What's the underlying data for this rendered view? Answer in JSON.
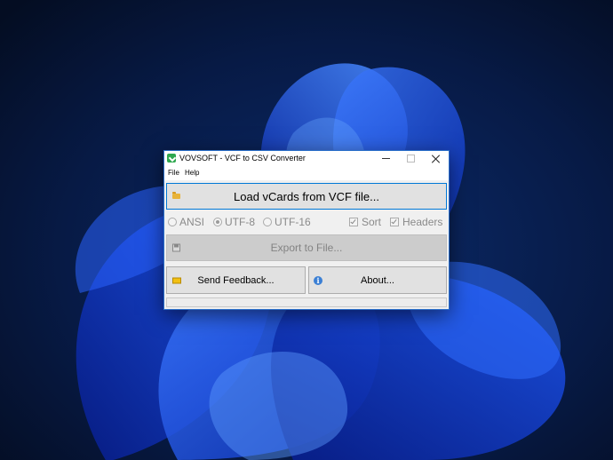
{
  "window": {
    "title": "VOVSOFT - VCF to CSV Converter"
  },
  "menu": {
    "items": [
      "File",
      "Help"
    ]
  },
  "buttons": {
    "load": "Load vCards from VCF file...",
    "export": "Export to File...",
    "feedback": "Send Feedback...",
    "about": "About..."
  },
  "options": {
    "encodings": [
      {
        "label": "ANSI",
        "selected": false
      },
      {
        "label": "UTF-8",
        "selected": true
      },
      {
        "label": "UTF-16",
        "selected": false
      }
    ],
    "checkboxes": [
      {
        "label": "Sort",
        "checked": true
      },
      {
        "label": "Headers",
        "checked": true
      }
    ]
  },
  "icons": {
    "app": "app-icon",
    "load": "folder-icon",
    "export": "floppy-disk-icon",
    "feedback": "envelope-icon",
    "about": "info-icon"
  },
  "colors": {
    "accent": "#0078d7",
    "desktop_bg": "#061533",
    "window_bg": "#f0f0f0"
  }
}
